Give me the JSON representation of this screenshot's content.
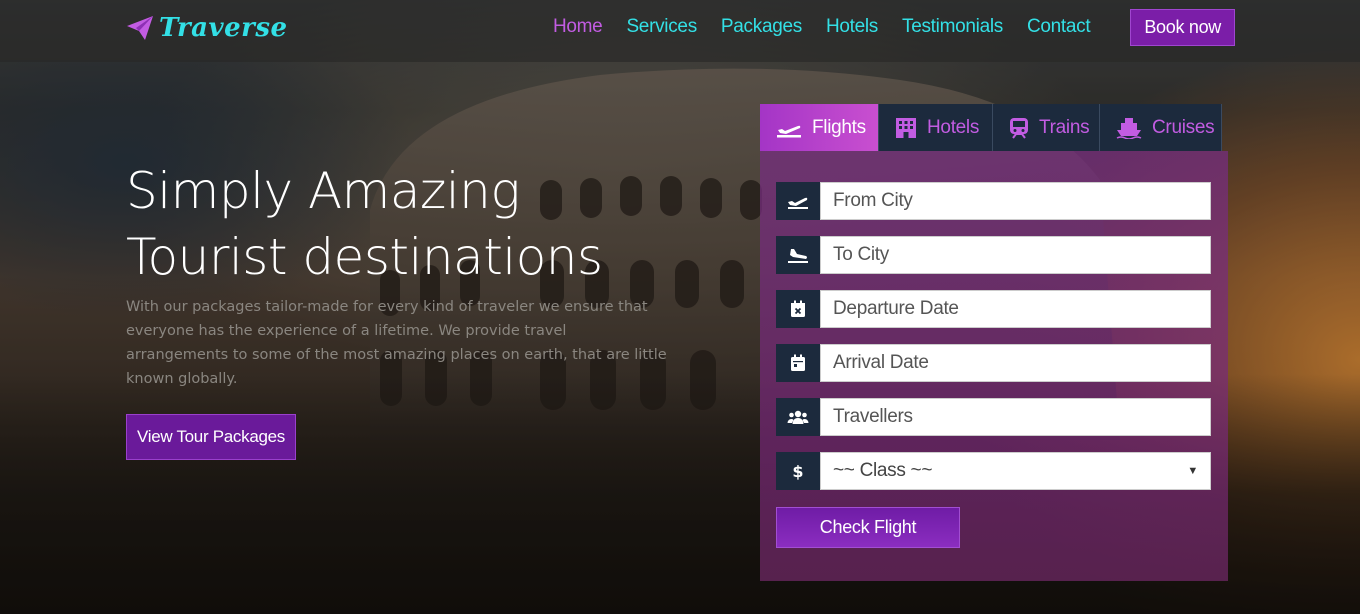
{
  "brand": {
    "name": "Traverse",
    "icon": "paper-plane-icon",
    "color": "#33e0e6"
  },
  "nav": {
    "links": [
      {
        "label": "Home",
        "active": true
      },
      {
        "label": "Services"
      },
      {
        "label": "Packages"
      },
      {
        "label": "Hotels"
      },
      {
        "label": "Testimonials"
      },
      {
        "label": "Contact"
      }
    ],
    "book_label": "Book now",
    "link_color": "#33e0e6",
    "active_color": "#c25ce2"
  },
  "hero": {
    "title_line1": "Simply Amazing",
    "title_line2": "Tourist destinations",
    "text": "With our packages tailor-made for every kind of traveler we ensure that everyone has the experience of a lifetime. We provide travel arrangements to some of the most amazing places on earth, that are little known globally.",
    "cta_label": "View Tour Packages"
  },
  "booking": {
    "tabs": [
      {
        "label": "Flights",
        "icon": "plane-icon",
        "active": true
      },
      {
        "label": "Hotels",
        "icon": "building-icon"
      },
      {
        "label": "Trains",
        "icon": "train-icon"
      },
      {
        "label": "Cruises",
        "icon": "ship-icon"
      }
    ],
    "fields": {
      "from": {
        "placeholder": "From City",
        "icon": "plane-departure-icon"
      },
      "to": {
        "placeholder": "To City",
        "icon": "plane-arrival-icon"
      },
      "departure": {
        "placeholder": "Departure Date",
        "icon": "calendar-x-icon"
      },
      "arrival": {
        "placeholder": "Arrival Date",
        "icon": "calendar-icon"
      },
      "travellers": {
        "placeholder": "Travellers",
        "icon": "users-icon"
      },
      "class": {
        "selected": "~~ Class ~~",
        "icon": "dollar-icon"
      }
    },
    "submit_label": "Check Flight",
    "accent": "#7b1ea8"
  }
}
